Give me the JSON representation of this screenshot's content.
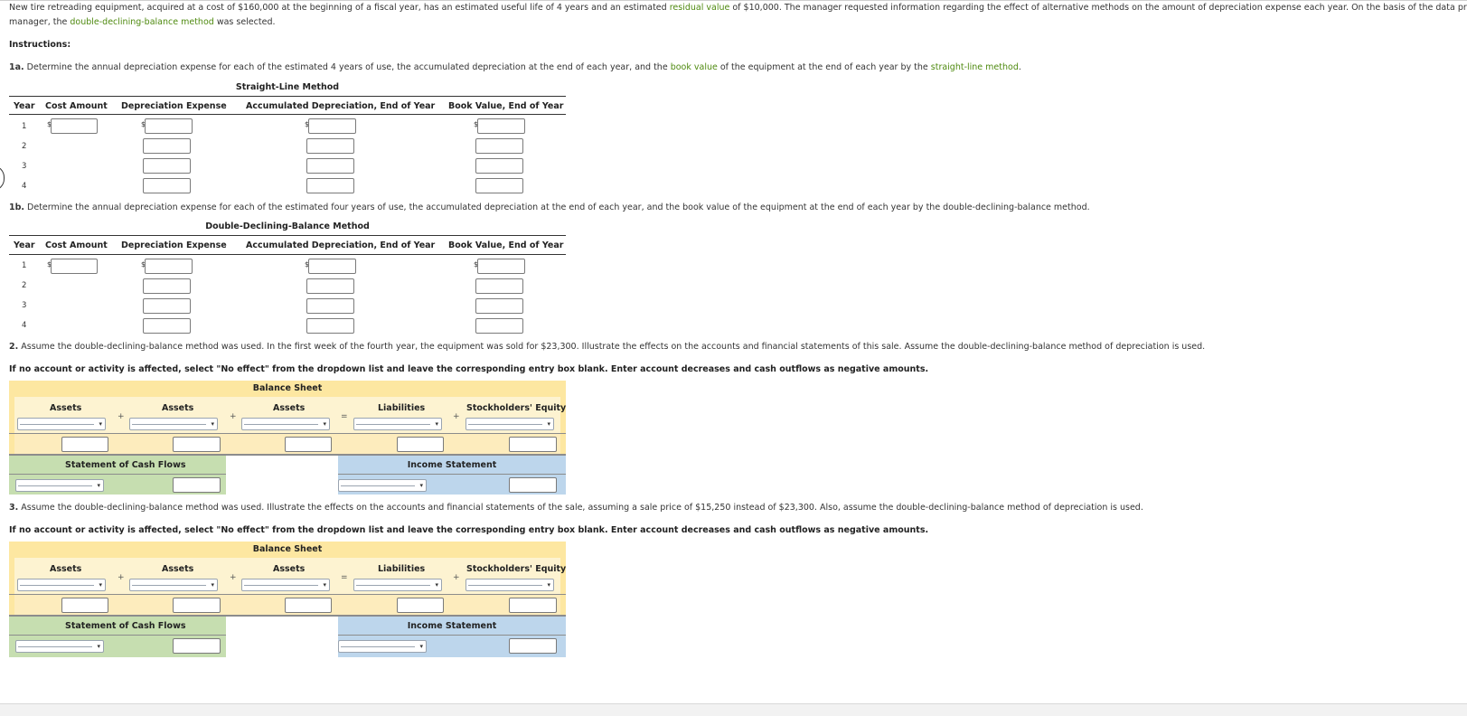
{
  "intro": {
    "line1_pre": "New tire retreading equipment, acquired at a cost of $160,000 at the beginning of a fiscal year, has an estimated useful life of 4 years and an estimated ",
    "line1_link": "residual value",
    "line1_post": " of $10,000. The manager requested information regarding the effect of alternative methods on the amount of depreciation expense each year. On the basis of the data presented to the",
    "line2_pre": "manager, the ",
    "line2_link": "double-declining-balance method",
    "line2_post": " was selected."
  },
  "instructions_label": "Instructions:",
  "q1a": {
    "num": "1a.",
    "text_pre": " Determine the annual depreciation expense for each of the estimated 4 years of use, the accumulated depreciation at the end of each year, and the ",
    "link1": "book value",
    "text_mid": " of the equipment at the end of each year by the ",
    "link2": "straight-line method",
    "text_post": ".",
    "table_title": "Straight-Line Method"
  },
  "q1b": {
    "num": "1b.",
    "text": " Determine the annual depreciation expense for each of the estimated four years of use, the accumulated depreciation at the end of each year, and the book value of the equipment at the end of each year by the double-declining-balance method.",
    "table_title": "Double-Declining-Balance Method"
  },
  "dep_table": {
    "col_year": "Year",
    "col_cost": "Cost Amount",
    "col_dep": "Depreciation Expense",
    "col_accum": "Accumulated Depreciation, End of Year",
    "col_book": "Book Value, End of Year",
    "years": [
      "1",
      "2",
      "3",
      "4"
    ],
    "currency": "$"
  },
  "q2": {
    "num": "2.",
    "text": " Assume the double-declining-balance method was used. In the first week of the fourth year, the equipment was sold for $23,300. Illustrate the effects on the accounts and financial statements of this sale. Assume the double-declining-balance method of depreciation is used."
  },
  "q3": {
    "num": "3.",
    "text": " Assume the double-declining-balance method was used. Illustrate the effects on the accounts and financial statements of the sale, assuming a sale price of $15,250 instead of $23,300. Also, assume the double-declining-balance method of depreciation is used."
  },
  "no_effect_note": "If no account or activity is affected, select \"No effect\" from the dropdown list and leave the corresponding entry box blank. Enter account decreases and cash outflows as negative amounts.",
  "effects_table": {
    "balance_sheet": "Balance Sheet",
    "assets": "Assets",
    "liabilities": "Liabilities",
    "equity": "Stockholders' Equity",
    "plus": "+",
    "equals": "=",
    "cash_flows": "Statement of Cash Flows",
    "income": "Income Statement"
  },
  "colors": {
    "link_green": "#4f8a10",
    "balance_sheet_yellow": "#fde7a1",
    "cash_flow_green": "#c6deb0",
    "income_blue": "#bdd6ec"
  }
}
